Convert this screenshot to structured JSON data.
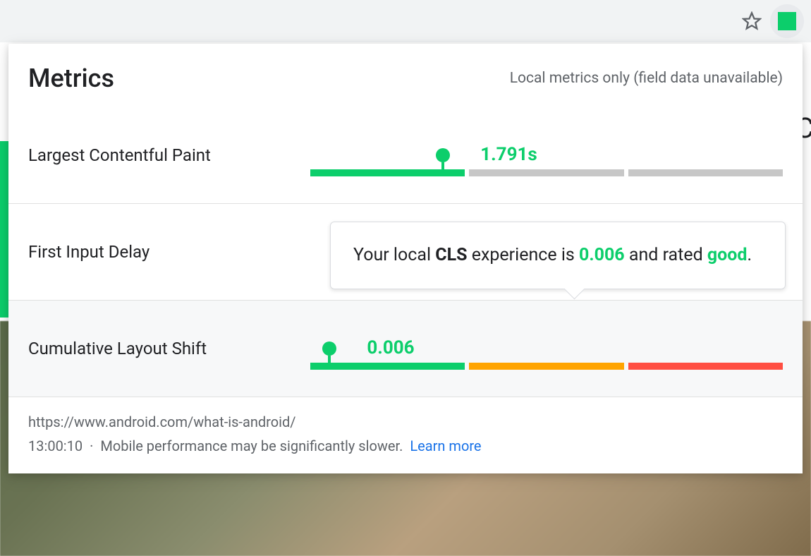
{
  "colors": {
    "good": "#0CCE6B",
    "needs_improvement": "#FFA400",
    "poor": "#FF4E42",
    "inactive": "#c7c7c7",
    "link": "#1a73e8"
  },
  "browser": {
    "extension_status": "good"
  },
  "panel": {
    "title": "Metrics",
    "subtitle": "Local metrics only (field data unavailable)"
  },
  "metrics": [
    {
      "id": "lcp",
      "label": "Largest Contentful Paint",
      "value_display": "1.791s",
      "rating": "good",
      "marker_percent": 28,
      "value_label_left_percent": 36,
      "segments": [
        {
          "color": "green",
          "flex": 33
        },
        {
          "color": "grey",
          "flex": 33
        },
        {
          "color": "grey",
          "flex": 33
        }
      ],
      "highlighted": false
    },
    {
      "id": "fid",
      "label": "First Input Delay",
      "value_display": "",
      "rating": "",
      "marker_percent": null,
      "segments": [],
      "highlighted": false
    },
    {
      "id": "cls",
      "label": "Cumulative Layout Shift",
      "value_display": "0.006",
      "rating": "good",
      "marker_percent": 4,
      "value_label_left_percent": 12,
      "segments": [
        {
          "color": "green",
          "flex": 33
        },
        {
          "color": "amber",
          "flex": 33
        },
        {
          "color": "red",
          "flex": 33
        }
      ],
      "highlighted": true
    }
  ],
  "tooltip": {
    "for_metric": "cls",
    "prefix": "Your local ",
    "abbr": "CLS",
    "mid1": " experience is ",
    "value": "0.006",
    "mid2": " and rated ",
    "rating": "good",
    "suffix": "."
  },
  "footer": {
    "url": "https://www.android.com/what-is-android/",
    "time": "13:00:10",
    "separator": "·",
    "note": "Mobile performance may be significantly slower.",
    "learn_more": "Learn more"
  }
}
